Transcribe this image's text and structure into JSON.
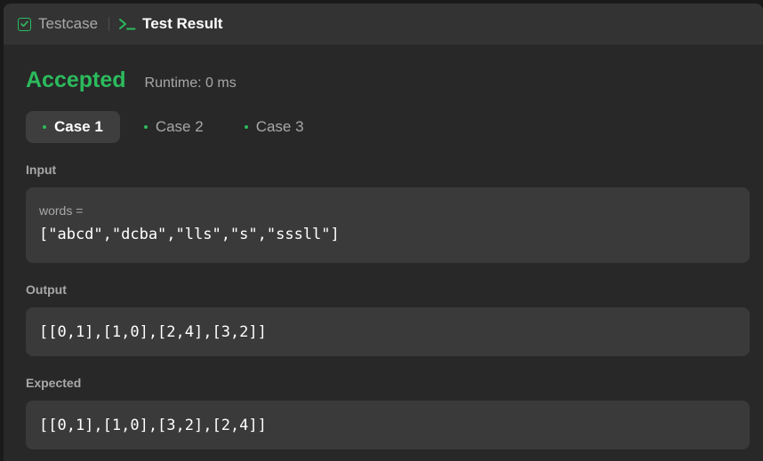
{
  "tabs": {
    "testcase_label": "Testcase",
    "result_label": "Test Result"
  },
  "result": {
    "status": "Accepted",
    "runtime": "Runtime: 0 ms"
  },
  "cases": [
    {
      "label": "Case 1",
      "active": true
    },
    {
      "label": "Case 2",
      "active": false
    },
    {
      "label": "Case 3",
      "active": false
    }
  ],
  "input": {
    "label": "Input",
    "var_name": "words =",
    "value": "[\"abcd\",\"dcba\",\"lls\",\"s\",\"sssll\"]"
  },
  "output": {
    "label": "Output",
    "value": "[[0,1],[1,0],[2,4],[3,2]]"
  },
  "expected": {
    "label": "Expected",
    "value": "[[0,1],[1,0],[3,2],[2,4]]"
  },
  "colors": {
    "accent_green": "#2cbb5d",
    "background": "#282828",
    "tabbar": "#333333",
    "box": "#3a3a3a"
  },
  "icons": {
    "testcase": "checkbox-check-icon",
    "result": "terminal-prompt-icon"
  }
}
